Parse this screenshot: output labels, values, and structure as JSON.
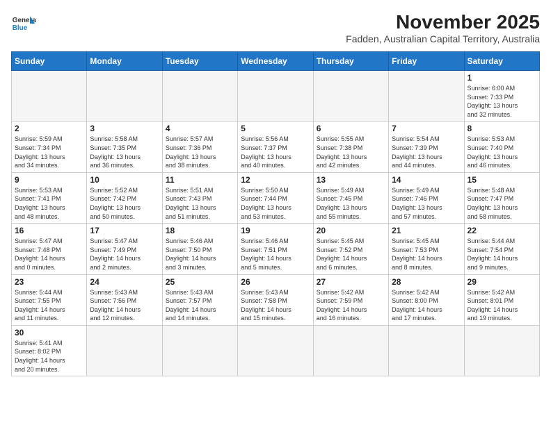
{
  "header": {
    "logo_general": "General",
    "logo_blue": "Blue",
    "month": "November 2025",
    "location": "Fadden, Australian Capital Territory, Australia"
  },
  "days_of_week": [
    "Sunday",
    "Monday",
    "Tuesday",
    "Wednesday",
    "Thursday",
    "Friday",
    "Saturday"
  ],
  "weeks": [
    [
      {
        "day": "",
        "info": ""
      },
      {
        "day": "",
        "info": ""
      },
      {
        "day": "",
        "info": ""
      },
      {
        "day": "",
        "info": ""
      },
      {
        "day": "",
        "info": ""
      },
      {
        "day": "",
        "info": ""
      },
      {
        "day": "1",
        "info": "Sunrise: 6:00 AM\nSunset: 7:33 PM\nDaylight: 13 hours\nand 32 minutes."
      }
    ],
    [
      {
        "day": "2",
        "info": "Sunrise: 5:59 AM\nSunset: 7:34 PM\nDaylight: 13 hours\nand 34 minutes."
      },
      {
        "day": "3",
        "info": "Sunrise: 5:58 AM\nSunset: 7:35 PM\nDaylight: 13 hours\nand 36 minutes."
      },
      {
        "day": "4",
        "info": "Sunrise: 5:57 AM\nSunset: 7:36 PM\nDaylight: 13 hours\nand 38 minutes."
      },
      {
        "day": "5",
        "info": "Sunrise: 5:56 AM\nSunset: 7:37 PM\nDaylight: 13 hours\nand 40 minutes."
      },
      {
        "day": "6",
        "info": "Sunrise: 5:55 AM\nSunset: 7:38 PM\nDaylight: 13 hours\nand 42 minutes."
      },
      {
        "day": "7",
        "info": "Sunrise: 5:54 AM\nSunset: 7:39 PM\nDaylight: 13 hours\nand 44 minutes."
      },
      {
        "day": "8",
        "info": "Sunrise: 5:53 AM\nSunset: 7:40 PM\nDaylight: 13 hours\nand 46 minutes."
      }
    ],
    [
      {
        "day": "9",
        "info": "Sunrise: 5:53 AM\nSunset: 7:41 PM\nDaylight: 13 hours\nand 48 minutes."
      },
      {
        "day": "10",
        "info": "Sunrise: 5:52 AM\nSunset: 7:42 PM\nDaylight: 13 hours\nand 50 minutes."
      },
      {
        "day": "11",
        "info": "Sunrise: 5:51 AM\nSunset: 7:43 PM\nDaylight: 13 hours\nand 51 minutes."
      },
      {
        "day": "12",
        "info": "Sunrise: 5:50 AM\nSunset: 7:44 PM\nDaylight: 13 hours\nand 53 minutes."
      },
      {
        "day": "13",
        "info": "Sunrise: 5:49 AM\nSunset: 7:45 PM\nDaylight: 13 hours\nand 55 minutes."
      },
      {
        "day": "14",
        "info": "Sunrise: 5:49 AM\nSunset: 7:46 PM\nDaylight: 13 hours\nand 57 minutes."
      },
      {
        "day": "15",
        "info": "Sunrise: 5:48 AM\nSunset: 7:47 PM\nDaylight: 13 hours\nand 58 minutes."
      }
    ],
    [
      {
        "day": "16",
        "info": "Sunrise: 5:47 AM\nSunset: 7:48 PM\nDaylight: 14 hours\nand 0 minutes."
      },
      {
        "day": "17",
        "info": "Sunrise: 5:47 AM\nSunset: 7:49 PM\nDaylight: 14 hours\nand 2 minutes."
      },
      {
        "day": "18",
        "info": "Sunrise: 5:46 AM\nSunset: 7:50 PM\nDaylight: 14 hours\nand 3 minutes."
      },
      {
        "day": "19",
        "info": "Sunrise: 5:46 AM\nSunset: 7:51 PM\nDaylight: 14 hours\nand 5 minutes."
      },
      {
        "day": "20",
        "info": "Sunrise: 5:45 AM\nSunset: 7:52 PM\nDaylight: 14 hours\nand 6 minutes."
      },
      {
        "day": "21",
        "info": "Sunrise: 5:45 AM\nSunset: 7:53 PM\nDaylight: 14 hours\nand 8 minutes."
      },
      {
        "day": "22",
        "info": "Sunrise: 5:44 AM\nSunset: 7:54 PM\nDaylight: 14 hours\nand 9 minutes."
      }
    ],
    [
      {
        "day": "23",
        "info": "Sunrise: 5:44 AM\nSunset: 7:55 PM\nDaylight: 14 hours\nand 11 minutes."
      },
      {
        "day": "24",
        "info": "Sunrise: 5:43 AM\nSunset: 7:56 PM\nDaylight: 14 hours\nand 12 minutes."
      },
      {
        "day": "25",
        "info": "Sunrise: 5:43 AM\nSunset: 7:57 PM\nDaylight: 14 hours\nand 14 minutes."
      },
      {
        "day": "26",
        "info": "Sunrise: 5:43 AM\nSunset: 7:58 PM\nDaylight: 14 hours\nand 15 minutes."
      },
      {
        "day": "27",
        "info": "Sunrise: 5:42 AM\nSunset: 7:59 PM\nDaylight: 14 hours\nand 16 minutes."
      },
      {
        "day": "28",
        "info": "Sunrise: 5:42 AM\nSunset: 8:00 PM\nDaylight: 14 hours\nand 17 minutes."
      },
      {
        "day": "29",
        "info": "Sunrise: 5:42 AM\nSunset: 8:01 PM\nDaylight: 14 hours\nand 19 minutes."
      }
    ],
    [
      {
        "day": "30",
        "info": "Sunrise: 5:41 AM\nSunset: 8:02 PM\nDaylight: 14 hours\nand 20 minutes."
      },
      {
        "day": "",
        "info": ""
      },
      {
        "day": "",
        "info": ""
      },
      {
        "day": "",
        "info": ""
      },
      {
        "day": "",
        "info": ""
      },
      {
        "day": "",
        "info": ""
      },
      {
        "day": "",
        "info": ""
      }
    ]
  ]
}
